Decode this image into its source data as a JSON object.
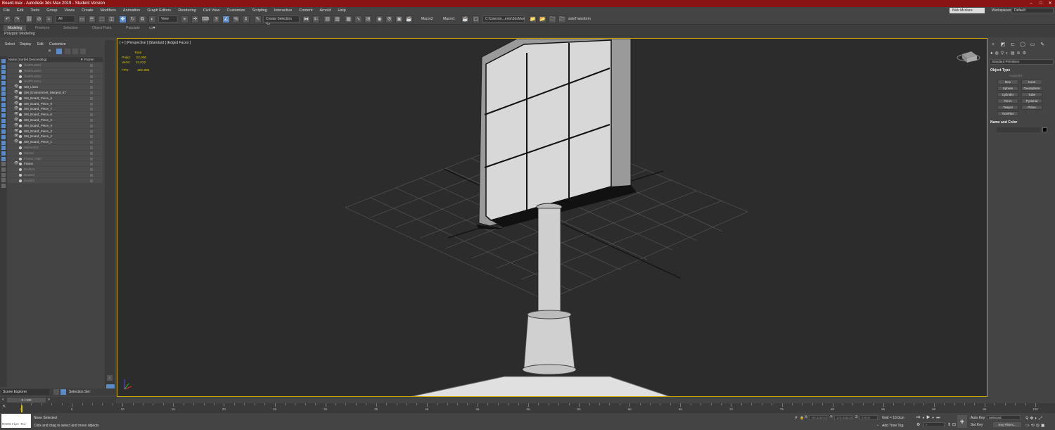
{
  "window": {
    "title": "Board.max - Autodesk 3ds Max 2019 - Student Version"
  },
  "menu": [
    "File",
    "Edit",
    "Tools",
    "Group",
    "Views",
    "Create",
    "Modifiers",
    "Animation",
    "Graph Editors",
    "Rendering",
    "Civil View",
    "Customize",
    "Scripting",
    "Interactive",
    "Content",
    "Arnold",
    "Help"
  ],
  "user": {
    "name": "Nick Mcclure",
    "workspaces_label": "Workspaces:",
    "workspace": "Default"
  },
  "toolbar": {
    "filter": "All",
    "ref_coord": "View",
    "selection_set": "Create Selection Se",
    "macro2": "Macro2",
    "macro1": "Macro1",
    "path": "C:\\Users\\n...ents\\3dsMax",
    "transform": "ssteTransform"
  },
  "ribbon": {
    "tabs": [
      "Modeling",
      "Freeform",
      "Selection",
      "Object Paint",
      "Populate"
    ],
    "active": "Modeling",
    "sub": "Polygon Modeling"
  },
  "explorer": {
    "menu": [
      "Select",
      "Display",
      "Edit",
      "Customize"
    ],
    "column_name": "Name (Sorted Descending)",
    "column_frozen": "▼ Frozen",
    "rows": [
      {
        "name": "TextPlus004",
        "visible": false
      },
      {
        "name": "TextPlus003",
        "visible": false
      },
      {
        "name": "TextPlus002",
        "visible": false
      },
      {
        "name": "TextPlus001",
        "visible": false
      },
      {
        "name": "SM_Lines",
        "visible": true
      },
      {
        "name": "SM_Environment_Merged_07",
        "visible": true
      },
      {
        "name": "SM_Board_Piece_9",
        "visible": true
      },
      {
        "name": "SM_Board_Piece_8",
        "visible": true
      },
      {
        "name": "SM_Board_Piece_7",
        "visible": true
      },
      {
        "name": "SM_Board_Piece_6",
        "visible": true
      },
      {
        "name": "SM_Board_Piece_5",
        "visible": true
      },
      {
        "name": "SM_Board_Piece_4",
        "visible": true
      },
      {
        "name": "SM_Board_Piece_3",
        "visible": true
      },
      {
        "name": "SM_Board_Piece_2",
        "visible": true
      },
      {
        "name": "SM_Board_Piece_1",
        "visible": true
      },
      {
        "name": "Marker001",
        "visible": false
      },
      {
        "name": "Marker",
        "visible": false
      },
      {
        "name": "Frame_High",
        "visible": false
      },
      {
        "name": "Frame",
        "visible": true
      },
      {
        "name": "Box004",
        "visible": false
      },
      {
        "name": "Box003",
        "visible": false
      },
      {
        "name": "Box002",
        "visible": false
      }
    ],
    "footer_label": "Scene Explorer",
    "selection_set_label": "Selection Set:"
  },
  "viewport": {
    "label": "[ + ] [Perspective ] [Standard ] [Edged Faces ]",
    "stats": {
      "total_label": "Total",
      "polys_label": "Polys:",
      "polys": "22,006",
      "verts_label": "Verts:",
      "verts": "12,022",
      "fps_label": "FPS:",
      "fps": "402.885"
    }
  },
  "command_panel": {
    "dropdown": "Standard Primitives",
    "object_type": "Object Type",
    "autogrid": "AutoGrid",
    "buttons": [
      "Box",
      "Cone",
      "Sphere",
      "GeoSphere",
      "Cylinder",
      "Tube",
      "Torus",
      "Pyramid",
      "Teapot",
      "Plane",
      "TextPlus"
    ],
    "name_and_color": "Name and Color"
  },
  "timeline": {
    "frame": "0 / 100",
    "ticks": [
      "0",
      "5",
      "10",
      "15",
      "20",
      "25",
      "30",
      "35",
      "40",
      "45",
      "50",
      "55",
      "60",
      "65",
      "70",
      "75",
      "80",
      "85",
      "90",
      "95",
      "100"
    ]
  },
  "status": {
    "maxscript": "MAXScript Mi:",
    "none_selected": "None Selected",
    "prompt": "Click and drag to select and move objects",
    "x_label": "X:",
    "x": "-80.425cm",
    "y_label": "Y:",
    "y": "179.338cm",
    "z_label": "Z:",
    "z": "0.0cm",
    "grid": "Grid = 10.0cm",
    "add_time_tag": "Add Time Tag",
    "auto_key": "Auto Key",
    "set_key": "Set Key",
    "selected": "Selected",
    "key_filters": "Key Filters...",
    "frame_field": "0"
  },
  "colors": {
    "title_bar": "#8a1414",
    "accent": "#5b8bc7",
    "viewport_border": "#c8a700",
    "stats": "#d8c400"
  }
}
